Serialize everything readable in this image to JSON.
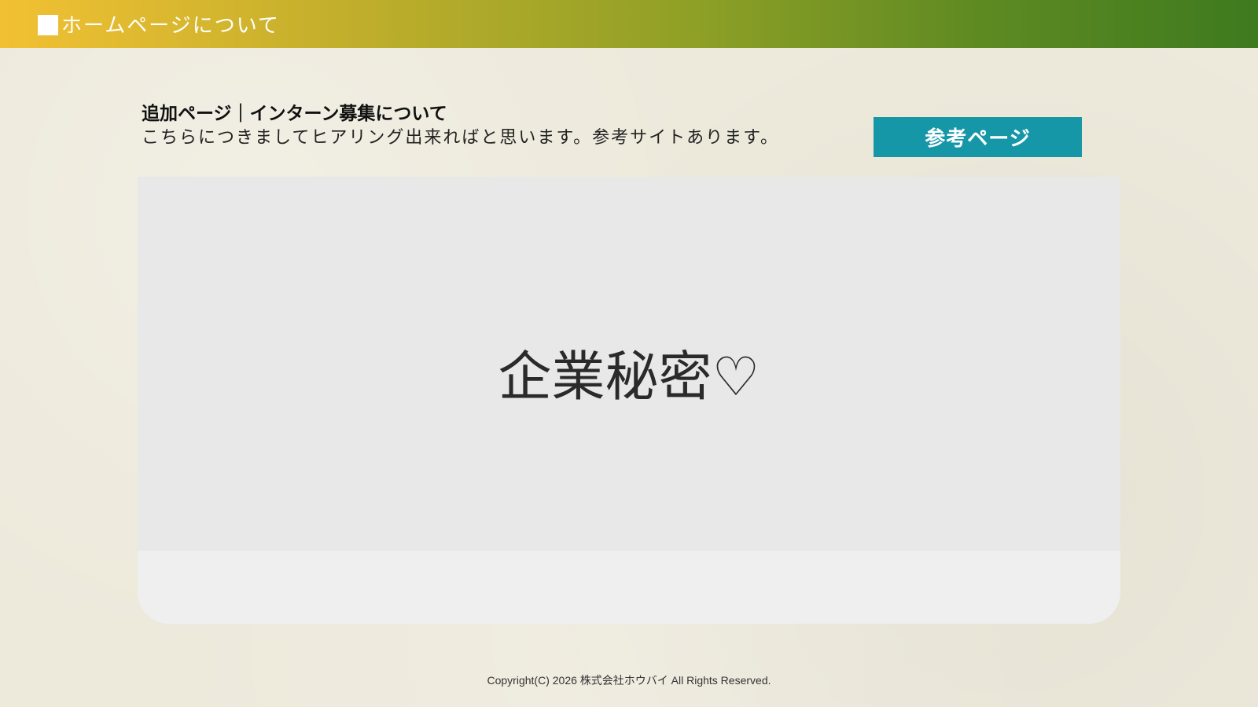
{
  "header": {
    "title": "ホームページについて",
    "colors": {
      "gradient_start": "#F2C133",
      "gradient_end": "#3E7A1F"
    }
  },
  "intro": {
    "title": "追加ページ｜インターン募集について",
    "description": "こちらにつきましてヒアリング出来ればと思います。参考サイトあります。"
  },
  "reference_button": {
    "label": "参考ページ",
    "color": "#1697A8"
  },
  "content": {
    "placeholder_text": "企業秘密♡"
  },
  "footer": {
    "copyright": "Copyright(C) 2026 株式会社ホウバイ All Rights Reserved."
  }
}
